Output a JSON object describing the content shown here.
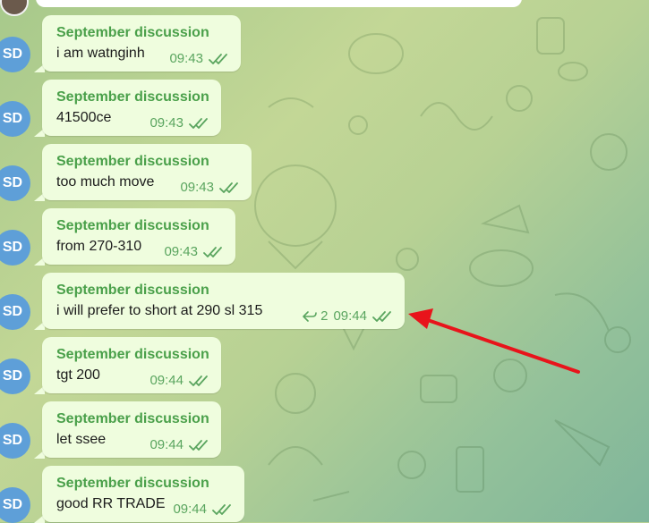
{
  "chat": {
    "messages": [
      {
        "avatar": "SD",
        "sender": "September discussion",
        "text": "i am watnginh",
        "time": "09:43"
      },
      {
        "avatar": "SD",
        "sender": "September discussion",
        "text": "41500ce",
        "time": "09:43"
      },
      {
        "avatar": "SD",
        "sender": "September discussion",
        "text": "too much move",
        "time": "09:43"
      },
      {
        "avatar": "SD",
        "sender": "September discussion",
        "text": "from 270-310",
        "time": "09:43"
      },
      {
        "avatar": "SD",
        "sender": "September discussion",
        "text": "i will prefer to short at 290 sl 315",
        "time": "09:44",
        "replies": "2"
      },
      {
        "avatar": "SD",
        "sender": "September discussion",
        "text": "tgt 200",
        "time": "09:44"
      },
      {
        "avatar": "SD",
        "sender": "September discussion",
        "text": "let ssee",
        "time": "09:44"
      },
      {
        "avatar": "SD",
        "sender": "September discussion",
        "text": "good RR TRADE",
        "time": "09:44"
      }
    ]
  },
  "colors": {
    "bubble": "#effdde",
    "sender": "#4aa04a",
    "meta": "#5aa55f",
    "avatar": "#5e9fd8",
    "annotation_arrow": "#e8141b"
  },
  "icons": {
    "read_status": "double-check-icon",
    "replies": "reply-arrow-icon"
  }
}
